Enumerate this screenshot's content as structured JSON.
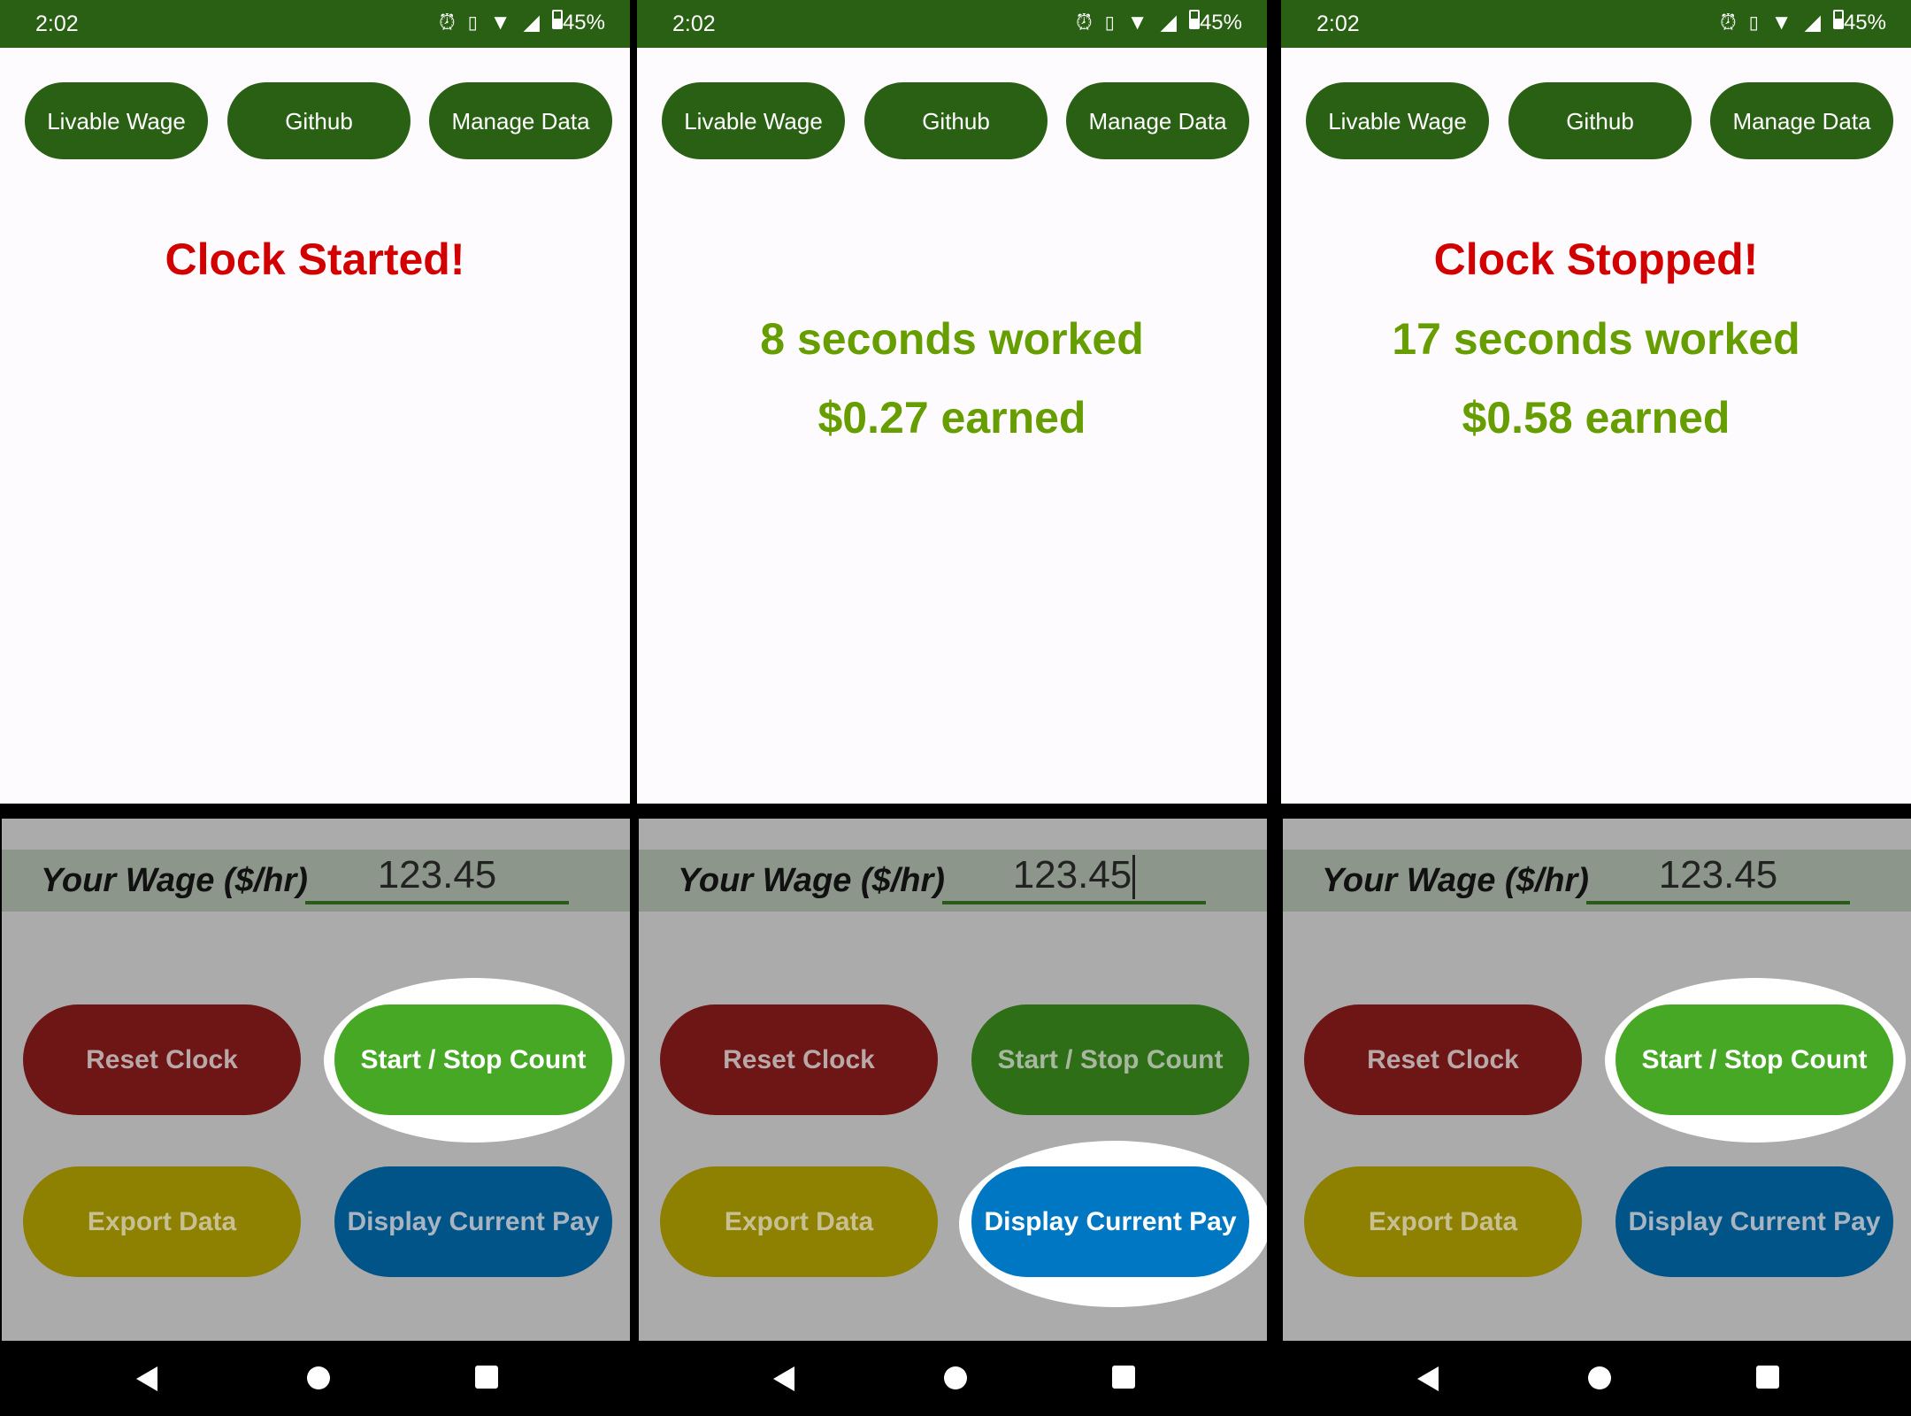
{
  "status_bar": {
    "time": "2:02",
    "battery": "45%",
    "icons": [
      "alarm-icon",
      "vibrate-icon",
      "wifi-icon",
      "signal-icon",
      "battery-icon"
    ]
  },
  "top_buttons": [
    "Livable Wage",
    "Github",
    "Manage Data"
  ],
  "wage_label": "Your Wage ($/hr)",
  "buttons": {
    "reset": "Reset Clock",
    "start_stop": "Start / Stop Count",
    "export": "Export Data",
    "display_pay": "Display Current Pay"
  },
  "colors": {
    "app_bar": "#296014",
    "reset": "#6e1515",
    "start_stop_active": "#47a826",
    "start_stop_inactive": "#2d6e17",
    "export": "#8e8000",
    "display_pay_active": "#0077c2",
    "display_pay_inactive": "#005487",
    "status_message": "#d20000",
    "result_text": "#669e00"
  },
  "screens": [
    {
      "status_message": "Clock Started!",
      "seconds_text": "",
      "earned_text": "",
      "wage_value": "123.45",
      "highlighted": "start_stop",
      "input_focused": false
    },
    {
      "status_message": "",
      "seconds_text": "8 seconds worked",
      "earned_text": "$0.27 earned",
      "wage_value": "123.45",
      "highlighted": "display_pay",
      "input_focused": true
    },
    {
      "status_message": "Clock Stopped!",
      "seconds_text": "17 seconds worked",
      "earned_text": "$0.58 earned",
      "wage_value": "123.45",
      "highlighted": "start_stop",
      "input_focused": false
    }
  ]
}
